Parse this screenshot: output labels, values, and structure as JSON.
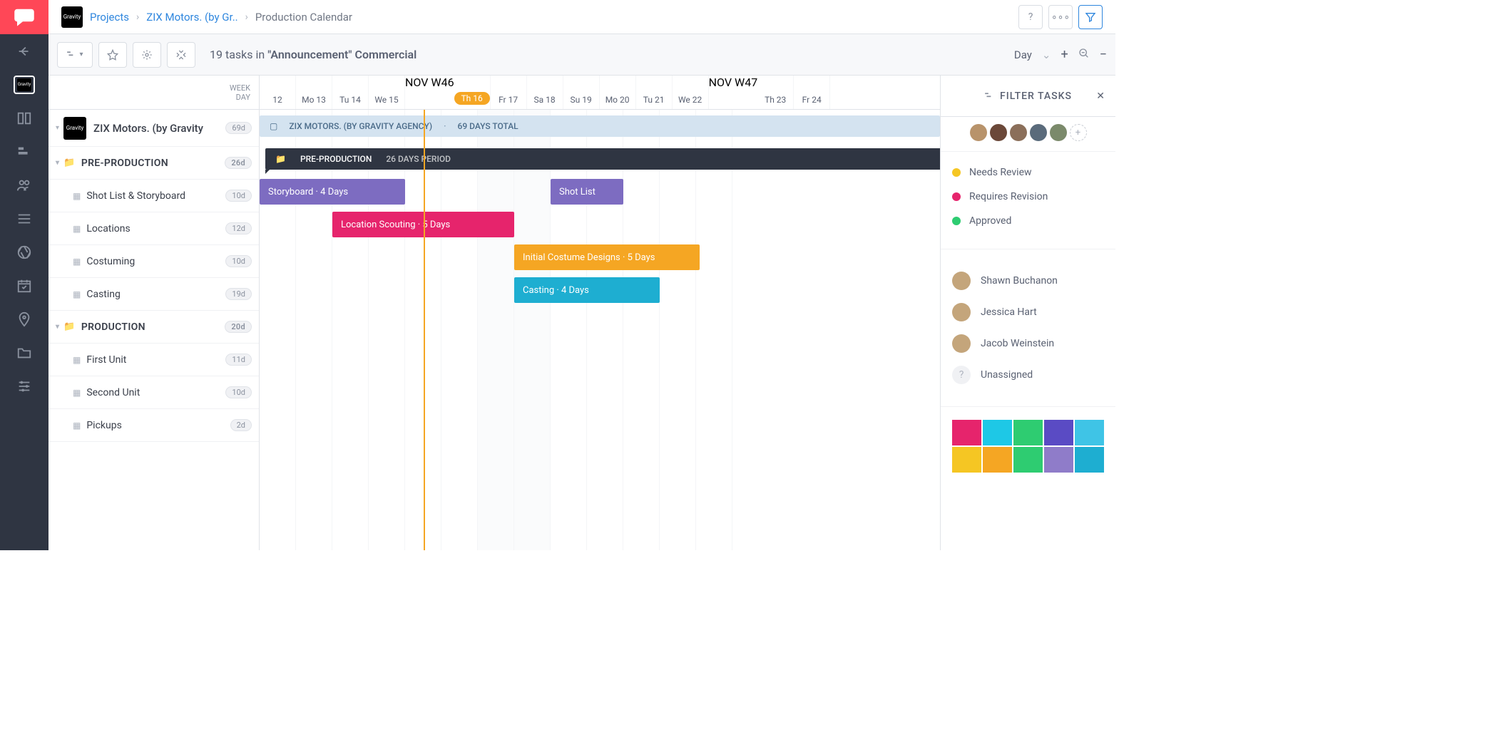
{
  "breadcrumb": {
    "projects": "Projects",
    "project": "ZIX Motors. (by Gr..",
    "page": "Production Calendar"
  },
  "toolbar": {
    "task_count_num": "19",
    "task_count_text": "tasks in",
    "task_count_quote": "\"Announcement\" Commercial",
    "view": "Day"
  },
  "timeline_headers": {
    "week_label": "WEEK",
    "day_label": "DAY",
    "days": [
      {
        "label": "12",
        "weekend": false
      },
      {
        "label": "Mo 13",
        "weekend": false
      },
      {
        "label": "Tu 14",
        "weekend": false
      },
      {
        "label": "We 15",
        "weekend": false
      },
      {
        "label": "Th 16",
        "today": true,
        "week": "NOV  W46"
      },
      {
        "label": "Fr 17",
        "weekend": false
      },
      {
        "label": "Sa 18",
        "weekend": true
      },
      {
        "label": "Su 19",
        "weekend": true
      },
      {
        "label": "Mo 20",
        "weekend": false
      },
      {
        "label": "Tu 21",
        "weekend": false
      },
      {
        "label": "We 22",
        "weekend": false
      },
      {
        "label": "Th 23",
        "week": "NOV  W47"
      },
      {
        "label": "Fr 24",
        "weekend": false
      }
    ]
  },
  "tree": {
    "project": {
      "name": "ZIX Motors. (by Gravity",
      "badge": "69d"
    },
    "sections": [
      {
        "name": "PRE-PRODUCTION",
        "badge": "26d",
        "tasks": [
          {
            "name": "Shot List & Storyboard",
            "badge": "10d"
          },
          {
            "name": "Locations",
            "badge": "12d"
          },
          {
            "name": "Costuming",
            "badge": "10d"
          },
          {
            "name": "Casting",
            "badge": "19d"
          }
        ]
      },
      {
        "name": "PRODUCTION",
        "badge": "20d",
        "tasks": [
          {
            "name": "First Unit",
            "badge": "11d"
          },
          {
            "name": "Second Unit",
            "badge": "10d"
          },
          {
            "name": "Pickups",
            "badge": "2d"
          }
        ]
      }
    ]
  },
  "gantt": {
    "project_bar": {
      "title": "ZIX MOTORS. (BY GRAVITY AGENCY)",
      "meta": "69 DAYS TOTAL"
    },
    "section_bar": {
      "title": "PRE-PRODUCTION",
      "meta": "26 DAYS PERIOD"
    },
    "bars": {
      "storyboard": "Storyboard · 4 Days",
      "shotlist": "Shot List",
      "location": "Location Scouting · 5 Days",
      "costume": "Initial Costume Designs · 5 Days",
      "casting": "Casting · 4 Days"
    }
  },
  "filter": {
    "title": "FILTER TASKS",
    "statuses": [
      {
        "label": "Needs Review",
        "color": "yellow"
      },
      {
        "label": "Requires Revision",
        "color": "red"
      },
      {
        "label": "Approved",
        "color": "green"
      }
    ],
    "people": [
      {
        "name": "Shawn Buchanon"
      },
      {
        "name": "Jessica Hart"
      },
      {
        "name": "Jacob Weinstein"
      },
      {
        "name": "Unassigned",
        "un": true
      }
    ],
    "colors": [
      "#e6246c",
      "#1ec8e6",
      "#2ecc71",
      "#5a4bc4",
      "#3fc4e6",
      "#f5c623",
      "#f5a623",
      "#2ecc71",
      "#8f7cc9",
      "#1eaed1"
    ]
  }
}
